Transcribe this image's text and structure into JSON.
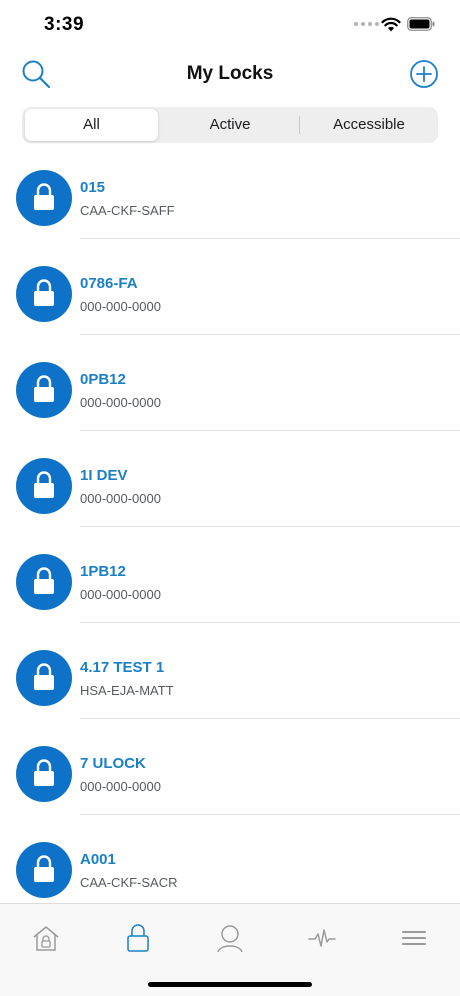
{
  "status_bar": {
    "time": "3:39"
  },
  "header": {
    "title": "My Locks"
  },
  "filter": {
    "tabs": [
      "All",
      "Active",
      "Accessible"
    ],
    "selected": "All"
  },
  "locks": [
    {
      "name": "015",
      "code": "CAA-CKF-SAFF"
    },
    {
      "name": "0786-FA",
      "code": "000-000-0000"
    },
    {
      "name": "0PB12",
      "code": "000-000-0000"
    },
    {
      "name": "1I DEV",
      "code": "000-000-0000"
    },
    {
      "name": "1PB12",
      "code": "000-000-0000"
    },
    {
      "name": "4.17 TEST 1",
      "code": "HSA-EJA-MATT"
    },
    {
      "name": "7 ULOCK",
      "code": "000-000-0000"
    },
    {
      "name": "A001",
      "code": "CAA-CKF-SACR"
    }
  ],
  "tab_bar": {
    "items": [
      {
        "icon": "house-lock-icon",
        "active": false
      },
      {
        "icon": "padlock-icon",
        "active": true
      },
      {
        "icon": "person-icon",
        "active": false
      },
      {
        "icon": "activity-icon",
        "active": false
      },
      {
        "icon": "menu-icon",
        "active": false
      }
    ]
  },
  "colors": {
    "accent": "#0e73c8",
    "lock_name": "#1b80c6",
    "tab_active": "#1b80c6",
    "tab_inactive": "#9a9a9a"
  }
}
